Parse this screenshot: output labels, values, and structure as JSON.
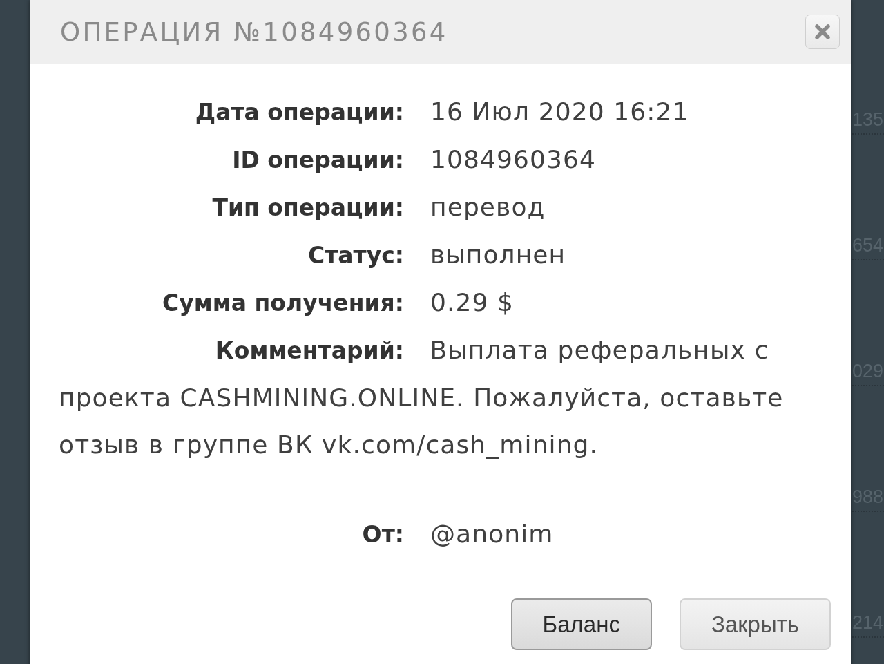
{
  "background_rows": [
    {
      "text": "135"
    },
    {
      "text": "654"
    },
    {
      "text": "029"
    },
    {
      "text": "988"
    },
    {
      "text": "214"
    }
  ],
  "dialog": {
    "title": "ОПЕРАЦИЯ №1084960364",
    "details": [
      {
        "label": "Дата операции:",
        "value": "16 Июл 2020 16:21"
      },
      {
        "label": "ID операции:",
        "value": "1084960364"
      },
      {
        "label": "Тип операции:",
        "value": "перевод"
      },
      {
        "label": "Статус:",
        "value": "выполнен"
      },
      {
        "label": "Сумма получения:",
        "value": "0.29 $"
      }
    ],
    "comment": {
      "label": "Комментарий:",
      "value": "Выплата реферальных с проекта CASHMINING.ONLINE. Пожалуйста, оставьте отзыв в группе ВК vk.com/cash_mining."
    },
    "sender": {
      "label": "От:",
      "value": "@anonim"
    },
    "buttons": [
      {
        "label": "Баланс",
        "focused": true
      },
      {
        "label": "Закрыть",
        "focused": false
      }
    ]
  }
}
